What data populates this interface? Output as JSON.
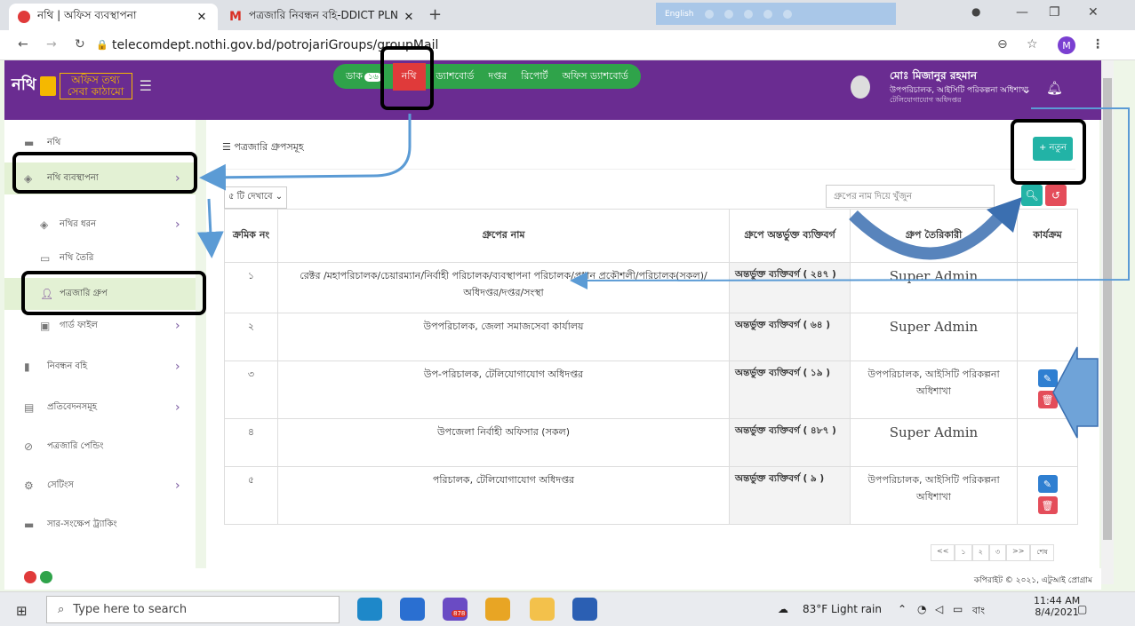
{
  "browser": {
    "tabs": [
      {
        "title": "নথি | অফিস ব্যবস্থাপনা",
        "active": true,
        "favicon_color": "#e03a3a"
      },
      {
        "title": "পত্রজারি নিবন্ধন বহি-DDICT PLN",
        "active": false,
        "favicon_color": "#d93025"
      }
    ],
    "lang_bar": "English",
    "url": "telecomdept.nothi.gov.bd/potrojariGroups/groupMail",
    "profile_initial": "M"
  },
  "header": {
    "logo_main": "নথি",
    "logo_sub": "অফিস তথ্য সেবা কাঠামো",
    "nav": [
      {
        "label": "ডাক",
        "badge": "১৬"
      },
      {
        "label": "নথি",
        "active": true
      },
      {
        "label": "ড্যাশবোর্ড"
      },
      {
        "label": "দপ্তর"
      },
      {
        "label": "রিপোর্ট"
      },
      {
        "label": "অফিস ড্যাশবোর্ড"
      }
    ],
    "user_name": "মোঃ মিজানুর রহমান",
    "user_desig": "উপপরিচালক, আইসিটি পরিকল্পনা অধিশাখা",
    "user_office": "টেলিযোগাযোগ অধিদপ্তর"
  },
  "sidebar": {
    "items": [
      {
        "label": "নথি",
        "icon": "folder-icon"
      },
      {
        "label": "নথি ব্যবস্থাপনা",
        "icon": "tag-icon",
        "selected": true,
        "arrow": true
      },
      {
        "label": "নথির ধরন",
        "icon": "tag-icon",
        "arrow": true,
        "sub": true
      },
      {
        "label": "নথি তৈরি",
        "icon": "file-icon",
        "sub": true
      },
      {
        "label": "পত্রজারি গ্রুপ",
        "icon": "user-icon",
        "selected": true,
        "sub": true
      },
      {
        "label": "গার্ড ফাইল",
        "icon": "guard-file-icon",
        "arrow": true,
        "sub": true
      },
      {
        "label": "নিবন্ধন বহি",
        "icon": "book-icon",
        "arrow": true
      },
      {
        "label": "প্রতিবেদনসমূহ",
        "icon": "report-icon",
        "arrow": true
      },
      {
        "label": "পত্রজারি পেন্ডিং",
        "icon": "pending-icon"
      },
      {
        "label": "সেটিংস",
        "icon": "settings-icon",
        "arrow": true
      },
      {
        "label": "সার-সংক্ষেপ ট্র্যাকিং",
        "icon": "tracking-icon"
      }
    ]
  },
  "main": {
    "title": "পত্রজারি গ্রুপসমূহ",
    "new_button": "+ নতুন",
    "per_page": "৫ টি দেখাবে",
    "search_placeholder": "গ্রুপের নাম দিয়ে খুঁজুন",
    "columns": [
      "ক্রমিক নং",
      "গ্রুপের নাম",
      "গ্রুপে অন্তর্ভুক্ত ব্যক্তিবর্গ",
      "গ্রুপ তৈরিকারী",
      "কার্যক্রম"
    ],
    "rows": [
      {
        "sl": "১",
        "name": "রেক্টর /মহাপরিচালক/চেয়ারম্যান/নির্বাহী পরিচালক/ব্যবস্থাপনা পরিচালক/প্রধান প্রকৌশলী/পরিচালক(সকল)/ অধিদপ্তর/দপ্তর/সংস্থা",
        "members": "অন্তর্ভুক্ত ব্যক্তিবর্গ ( ২৪৭ )",
        "creator": "Super Admin",
        "actions": false
      },
      {
        "sl": "২",
        "name": "উপপরিচালক, জেলা সমাজসেবা কার্যালয়",
        "members": "অন্তর্ভুক্ত ব্যক্তিবর্গ ( ৬৪ )",
        "creator": "Super Admin",
        "actions": false
      },
      {
        "sl": "৩",
        "name": "উপ-পরিচালক, টেলিযোগাযোগ অধিদপ্তর",
        "members": "অন্তর্ভুক্ত ব্যক্তিবর্গ ( ১৯ )",
        "creator": "উপপরিচালক, আইসিটি পরিকল্পনা অধিশাখা",
        "actions": true
      },
      {
        "sl": "৪",
        "name": "উপজেলা নির্বাহী অফিসার (সকল)",
        "members": "অন্তর্ভুক্ত ব্যক্তিবর্গ ( ৪৮৭ )",
        "creator": "Super Admin",
        "actions": false
      },
      {
        "sl": "৫",
        "name": "পরিচালক, টেলিযোগাযোগ অধিদপ্তর",
        "members": "অন্তর্ভুক্ত ব্যক্তিবর্গ ( ৯ )",
        "creator": "উপপরিচালক, আইসিটি পরিকল্পনা অধিশাখা",
        "actions": true
      }
    ],
    "pager": [
      "<<",
      "১",
      "২",
      "৩",
      ">>",
      "শেষ"
    ]
  },
  "footer": {
    "copyright": "কপিরাইট © ২০২১, এটুআই প্রোগ্রাম"
  },
  "taskbar": {
    "search_placeholder": "Type here to search",
    "weather": "83°F Light rain",
    "lang": "বাং",
    "time": "11:44 AM",
    "date": "8/4/2021",
    "badge": "878"
  },
  "colors": {
    "header": "#6a2c91",
    "nav_green": "#2fa34a",
    "active_red": "#e03a3a",
    "teal": "#22b3a6",
    "annotation_blue": "#5b9bd5"
  }
}
